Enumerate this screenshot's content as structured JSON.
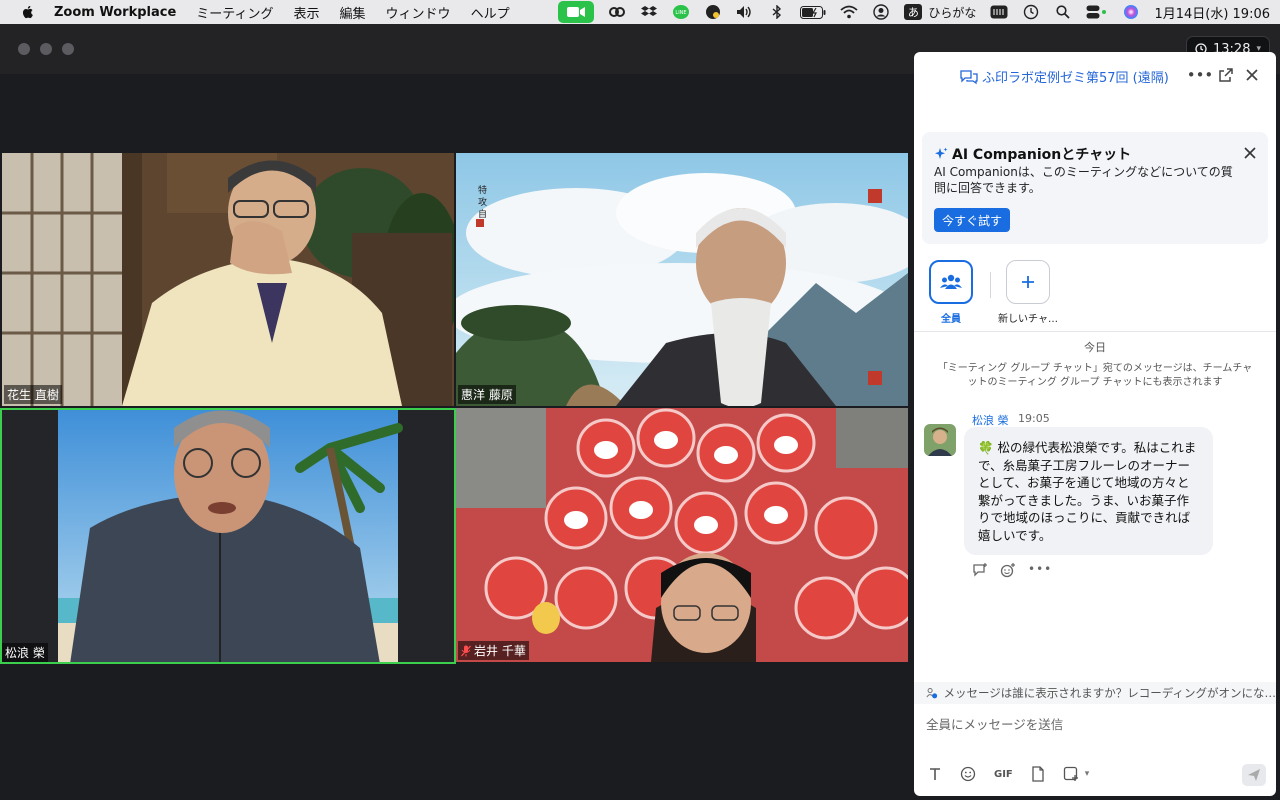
{
  "menubar": {
    "app_name": "Zoom Workplace",
    "menus": [
      "ミーティング",
      "表示",
      "編集",
      "ウィンドウ",
      "ヘルプ"
    ],
    "ime_char": "あ",
    "ime_label": "ひらがな",
    "datetime": "1月14日(水)  19:06",
    "accent_color": "#2bc24a"
  },
  "window": {
    "timer": "13:28"
  },
  "participants": [
    {
      "name": "花生 直樹",
      "muted": false,
      "active": false
    },
    {
      "name": "惠洋 藤原",
      "muted": false,
      "active": false
    },
    {
      "name": "松浪 榮",
      "muted": false,
      "active": true
    },
    {
      "name": "岩井 千華",
      "muted": true,
      "active": false
    }
  ],
  "chat": {
    "title": "ふ印ラボ定例ゼミ第57回 (遠隔)",
    "ai_card": {
      "title": "AI Companionとチャット",
      "description": "AI Companionは、このミーティングなどについての質問に回答できます。",
      "try_button": "今すぐ試す"
    },
    "recipients": {
      "everyone_label": "全員",
      "new_chat_label": "新しいチャ…"
    },
    "date_separator": "今日",
    "system_note": "「ミーティング グループ チャット」宛てのメッセージは、チームチャットのミーティング グループ チャットにも表示されます",
    "messages": [
      {
        "sender": "松浪 榮",
        "time": "19:05",
        "text": "🍀 松の緑代表松浪榮です。私はこれまで、糸島菓子工房フルーレのオーナーとして、お菓子を通じて地域の方々と繋がってきました。うま、いお菓子作りで地域のほっこりに、貢献できれば嬉しいです。"
      }
    ],
    "notice": "メッセージは誰に表示されますか？レコーディングがオンにな…",
    "input_placeholder": "全員にメッセージを送信",
    "toolbar_gif": "GIF",
    "accent_color": "#1a6de0"
  }
}
